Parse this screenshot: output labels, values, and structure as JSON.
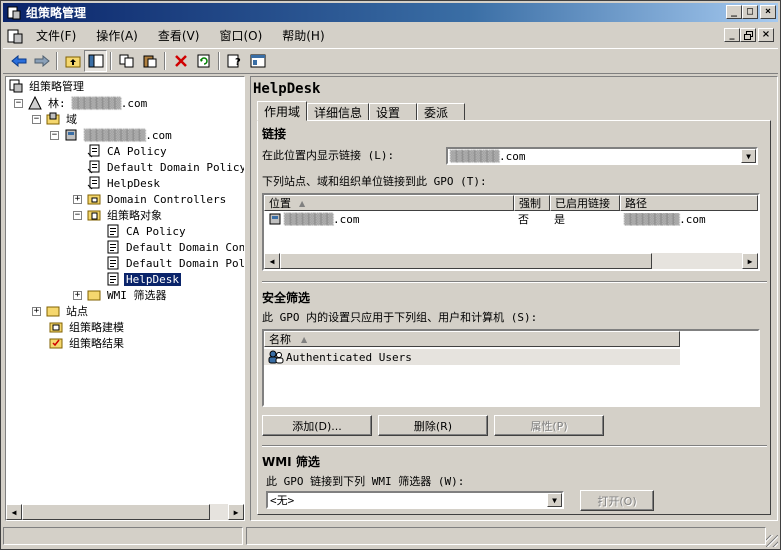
{
  "window": {
    "title": "组策略管理",
    "min": "_",
    "max": "□",
    "close": "×"
  },
  "menu": [
    "文件(F)",
    "操作(A)",
    "查看(V)",
    "窗口(O)",
    "帮助(H)"
  ],
  "tree": {
    "root": "组策略管理",
    "forest_prefix": "林:",
    "forest_domain": ".com",
    "domains": "域",
    "domain": ".com",
    "items": [
      "CA Policy",
      "Default Domain Policy",
      "HelpDesk",
      "Domain Controllers",
      "组策略对象"
    ],
    "gpos": [
      "CA Policy",
      "Default Domain Controllers Policy",
      "Default Domain Policy",
      "HelpDesk"
    ],
    "wmi": "WMI 筛选器",
    "sites": "站点",
    "modeling": "组策略建模",
    "results": "组策略结果"
  },
  "details": {
    "title": "HelpDesk",
    "tabs": [
      "作用域",
      "详细信息",
      "设置",
      "委派"
    ],
    "links": {
      "heading": "链接",
      "location_label": "在此位置内显示链接 (L):",
      "location_value": ".com",
      "list_label": "下列站点、域和组织单位链接到此 GPO (T):",
      "columns": [
        "位置",
        "强制",
        "已启用链接",
        "路径"
      ],
      "rows": [
        {
          "location": ".com",
          "enforced": "否",
          "enabled": "是",
          "path": ".com"
        }
      ]
    },
    "security": {
      "heading": "安全筛选",
      "label": "此 GPO 内的设置只应用于下列组、用户和计算机 (S):",
      "column": "名称",
      "rows": [
        "Authenticated Users"
      ],
      "buttons": {
        "add": "添加(D)...",
        "remove": "删除(R)",
        "properties": "属性(P)"
      }
    },
    "wmi": {
      "heading": "WMI 筛选",
      "label": "此 GPO 链接到下列 WMI 筛选器 (W):",
      "value": "<无>",
      "open": "打开(O)"
    }
  }
}
